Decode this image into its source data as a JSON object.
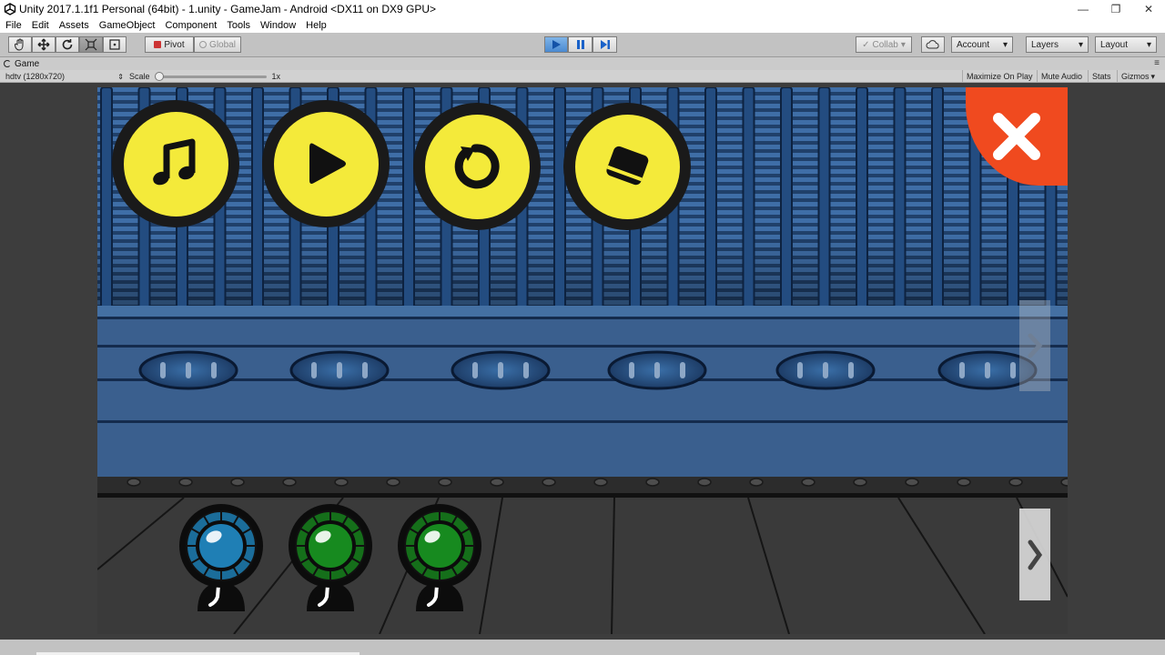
{
  "window": {
    "title": "Unity 2017.1.1f1 Personal (64bit) - 1.unity - GameJam - Android <DX11 on DX9 GPU>",
    "minimize": "—",
    "restore": "❐",
    "close": "✕"
  },
  "menu": [
    "File",
    "Edit",
    "Assets",
    "GameObject",
    "Component",
    "Tools",
    "Window",
    "Help"
  ],
  "toolbar": {
    "pivot_label": "Pivot",
    "global_label": "Global",
    "collab_label": "Collab",
    "account_label": "Account",
    "layers_label": "Layers",
    "layout_label": "Layout",
    "dropdown_arrow": "▾"
  },
  "game_tab": {
    "label": "Game",
    "menu_glyph": "≡"
  },
  "game_bar": {
    "resolution": "hdtv (1280x720)",
    "scale_label": "Scale",
    "scale_value": "1x",
    "scale_fraction": 0.0,
    "maximize_label": "Maximize On Play",
    "mute_label": "Mute Audio",
    "stats_label": "Stats",
    "gizmos_label": "Gizmos",
    "gizmos_arrow": "▾"
  },
  "game": {
    "buttons": [
      {
        "icon": "music-note-icon"
      },
      {
        "icon": "play-icon"
      },
      {
        "icon": "restart-icon"
      },
      {
        "icon": "eraser-icon"
      }
    ],
    "close_icon": "close-icon",
    "machines": [
      {
        "color": "#1f7fb5",
        "ring": "#1b6d9a"
      },
      {
        "color": "#178a1f",
        "ring": "#156f1a"
      },
      {
        "color": "#178a1f",
        "ring": "#156f1a"
      }
    ],
    "colors": {
      "button_yellow": "#f4ea3a",
      "close_red": "#f04a1f",
      "wall_blue": "#2f5a90",
      "floor_dark": "#3a3a3a"
    }
  }
}
